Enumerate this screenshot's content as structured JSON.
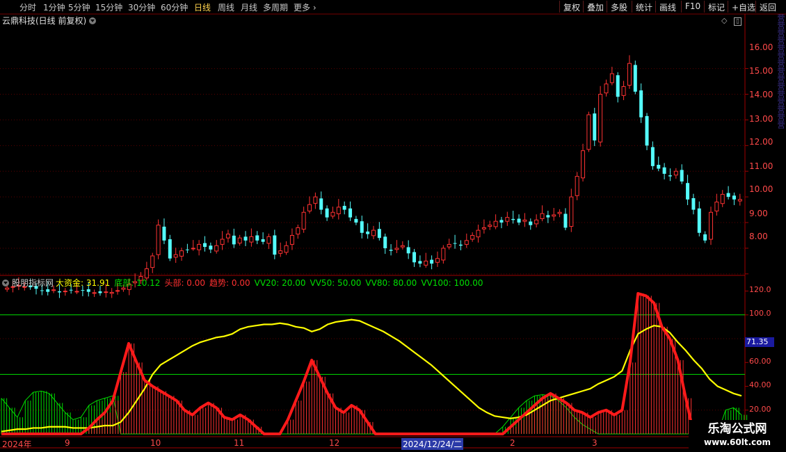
{
  "toolbar": {
    "periods": [
      "分时",
      "1分钟",
      "5分钟",
      "15分钟",
      "30分钟",
      "60分钟",
      "日线",
      "周线",
      "月线",
      "多周期",
      "更多"
    ],
    "active_period": "日线",
    "buttons": [
      "复权",
      "叠加",
      "多股",
      "统计",
      "画线",
      "F10",
      "标记",
      "+自选",
      "返回"
    ]
  },
  "stock_title": "云鼎科技(日线 前复权)",
  "indicator": {
    "name": "股朋指标网",
    "items": [
      {
        "label": "大资金: 31.91",
        "color": "#ffff00"
      },
      {
        "label": "底部: 10.12",
        "color": "#00e000"
      },
      {
        "label": "头部: 0.00",
        "color": "#ff3030"
      },
      {
        "label": "趋势: 0.00",
        "color": "#ff3030"
      },
      {
        "label": "VV20: 20.00",
        "color": "#00e000"
      },
      {
        "label": "VV50: 50.00",
        "color": "#00e000"
      },
      {
        "label": "VV80: 80.00",
        "color": "#00e000"
      },
      {
        "label": "VV100: 100.00",
        "color": "#00e000"
      }
    ]
  },
  "price_axis": [
    "16.00",
    "15.00",
    "14.00",
    "13.00",
    "12.00",
    "11.00",
    "10.00",
    "9.00",
    "8.00"
  ],
  "ind_axis": [
    "120.0",
    "100.0",
    "80.00",
    "60.00",
    "40.00",
    "20.00"
  ],
  "current_value": "71.35",
  "dates": [
    "2024年",
    "9",
    "10",
    "11",
    "12",
    "2024/12/24/二",
    "2",
    "3"
  ],
  "selected_date": "2024/12/24/二",
  "watermark": {
    "line1": "乐淘公式网",
    "line2": "www.60lt.com"
  },
  "side_text": "营营营营营营营营营营营营营营营",
  "colors": {
    "up": "#ff3232",
    "down": "#54fcfc",
    "yellow": "#ffff00",
    "green": "#00e000",
    "red": "#ff1a1a",
    "axis": "#ff4a4a"
  },
  "chart_data": {
    "type": "candlestick",
    "price_ylim": [
      7.4,
      17.1
    ],
    "closes": [
      7.45,
      7.5,
      7.55,
      7.5,
      7.48,
      7.42,
      7.35,
      7.3,
      7.38,
      7.28,
      7.33,
      7.37,
      7.32,
      7.35,
      7.3,
      7.27,
      7.25,
      7.3,
      7.28,
      7.35,
      7.45,
      7.6,
      7.7,
      7.9,
      8.2,
      8.7,
      9.9,
      9.3,
      8.6,
      8.75,
      8.9,
      8.95,
      9.0,
      9.15,
      9.05,
      8.95,
      9.1,
      9.35,
      9.55,
      9.15,
      9.4,
      9.3,
      9.45,
      9.3,
      9.25,
      9.45,
      8.75,
      8.9,
      9.1,
      9.5,
      9.8,
      10.4,
      10.7,
      11.0,
      10.5,
      10.2,
      10.4,
      10.6,
      10.5,
      10.2,
      10.0,
      9.6,
      9.55,
      9.7,
      9.4,
      9.0,
      8.9,
      9.0,
      9.1,
      8.8,
      8.45,
      8.4,
      8.5,
      8.4,
      8.6,
      9.0,
      9.15,
      9.2,
      9.1,
      9.3,
      9.5,
      9.7,
      9.8,
      9.9,
      10.05,
      10.0,
      10.2,
      10.1,
      10.0,
      10.1,
      9.9,
      10.1,
      10.35,
      10.2,
      10.3,
      10.4,
      9.8,
      11.0,
      11.8,
      12.8,
      14.2,
      13.2,
      15.0,
      15.4,
      15.8,
      14.9,
      15.3,
      16.2,
      15.1,
      14.1,
      13.0,
      12.2,
      12.1,
      11.9,
      11.8,
      12.0,
      11.6,
      10.9,
      10.5,
      9.6,
      9.3,
      10.4,
      10.8,
      11.1,
      11.0,
      10.9,
      10.9
    ]
  },
  "indicator_data": {
    "ylim": [
      0,
      125
    ],
    "yellow": [
      2,
      3,
      4,
      4,
      5,
      5,
      6,
      6,
      6,
      5,
      5,
      5,
      6,
      7,
      7,
      10,
      18,
      28,
      38,
      50,
      58,
      62,
      66,
      70,
      74,
      77,
      79,
      81,
      82,
      84,
      88,
      90,
      91,
      92,
      92,
      93,
      92,
      90,
      89,
      86,
      88,
      92,
      94,
      95,
      96,
      95,
      92,
      89,
      86,
      82,
      78,
      73,
      68,
      63,
      58,
      52,
      46,
      40,
      34,
      28,
      22,
      18,
      15,
      14,
      13,
      14,
      16,
      20,
      24,
      28,
      30,
      32,
      34,
      36,
      38,
      42,
      45,
      48,
      53,
      70,
      84,
      88,
      91,
      90,
      85,
      77,
      70,
      62,
      55,
      46,
      40,
      37,
      34,
      32
    ],
    "red": [
      0,
      0,
      0,
      0,
      0,
      0,
      0,
      0,
      0,
      0,
      0,
      5,
      12,
      18,
      28,
      52,
      76,
      60,
      45,
      40,
      36,
      32,
      28,
      20,
      16,
      22,
      26,
      22,
      14,
      12,
      16,
      12,
      6,
      0,
      0,
      0,
      12,
      28,
      44,
      62,
      48,
      34,
      22,
      18,
      24,
      20,
      10,
      0,
      0,
      0,
      0,
      0,
      0,
      0,
      0,
      0,
      0,
      0,
      0,
      0,
      0,
      0,
      0,
      0,
      6,
      12,
      18,
      24,
      30,
      34,
      30,
      26,
      20,
      18,
      14,
      18,
      20,
      16,
      20,
      60,
      118,
      116,
      110,
      90,
      80,
      62,
      30,
      0,
      0,
      0,
      0,
      0,
      0,
      0
    ],
    "green": [
      30,
      22,
      14,
      28,
      35,
      36,
      34,
      26,
      18,
      12,
      14,
      24,
      28,
      30,
      32,
      0,
      0,
      0,
      0,
      0,
      0,
      0,
      0,
      0,
      0,
      0,
      0,
      0,
      0,
      0,
      0,
      0,
      0,
      0,
      0,
      0,
      0,
      0,
      0,
      0,
      0,
      0,
      0,
      0,
      0,
      0,
      0,
      0,
      0,
      0,
      0,
      0,
      0,
      0,
      0,
      0,
      0,
      0,
      0,
      0,
      0,
      0,
      0,
      6,
      14,
      22,
      28,
      32,
      33,
      32,
      28,
      22,
      14,
      8,
      4,
      0,
      0,
      0,
      0,
      0,
      0,
      0,
      0,
      0,
      0,
      0,
      0,
      0,
      0,
      0,
      0,
      20,
      22,
      16
    ]
  }
}
